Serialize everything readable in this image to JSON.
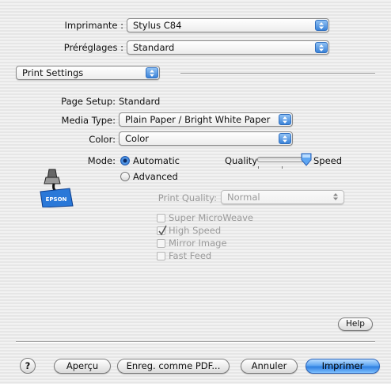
{
  "printer": {
    "label": "Imprimante :",
    "value": "Stylus C84"
  },
  "presets": {
    "label": "Préréglages :",
    "value": "Standard"
  },
  "panel": {
    "value": "Print Settings"
  },
  "settings": {
    "page_setup_label": "Page Setup:",
    "page_setup_value": "Standard",
    "media_type_label": "Media Type:",
    "media_type_value": "Plain Paper / Bright White Paper",
    "color_label": "Color:",
    "color_value": "Color",
    "mode_label": "Mode:",
    "mode_automatic": "Automatic",
    "mode_advanced": "Advanced",
    "mode_selected": "Automatic",
    "quality_label": "Quality",
    "speed_label": "Speed",
    "quality_speed_level": 1.0,
    "print_quality_label": "Print Quality:",
    "print_quality_value": "Normal"
  },
  "options": [
    {
      "label": "Super MicroWeave",
      "checked": false
    },
    {
      "label": "High Speed",
      "checked": true
    },
    {
      "label": "Mirror Image",
      "checked": false
    },
    {
      "label": "Fast Feed",
      "checked": false
    }
  ],
  "logo_text": "EPSON",
  "buttons": {
    "help": "Help",
    "help_icon": "?",
    "preview": "Aperçu",
    "save_pdf": "Enreg. comme PDF...",
    "cancel": "Annuler",
    "print": "Imprimer"
  }
}
